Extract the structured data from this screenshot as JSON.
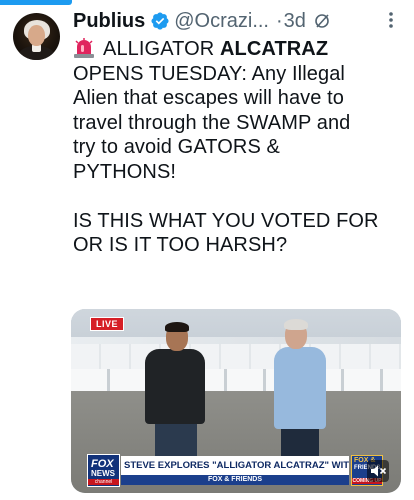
{
  "tweet": {
    "author_name": "Publius",
    "handle": "@Ocrazi...",
    "separator": "·",
    "time": "3d",
    "lines": [
      "ALLIGATOR ALCATRAZ",
      "OPENS TUESDAY: Any Illegal",
      "Alien that escapes will have to",
      "travel through the SWAMP and",
      "try to avoid GATORS &",
      "PYTHONS!",
      "IS THIS WHAT YOU VOTED FOR",
      "OR IS IT TOO HARSH?"
    ],
    "first_word": "ALLIGATOR",
    "first_bold": "ALCATRAZ"
  },
  "media": {
    "live_badge": "LIVE",
    "chyron_headline": "STEVE EXPLORES \"ALLIGATOR ALCATRAZ\" WITH DESANTIS",
    "show_name": "FOX & FRIENDS",
    "network_logo_line1": "FOX",
    "network_logo_line2": "NEWS",
    "network_logo_line3": "channel",
    "show_logo_line1": "FOX &",
    "show_logo_line2": "FRIENDS",
    "show_logo_line3": "COMING UP"
  },
  "colors": {
    "accent": "#1d9bf0",
    "verified": "#1d9bf0",
    "text": "#0f1419",
    "muted": "#536471",
    "siren": "#e0245e"
  },
  "icons": {
    "verified": "verified-badge-icon",
    "grok": "sparkle-icon",
    "more": "more-dots-icon",
    "siren": "siren-emoji-icon",
    "mute": "speaker-muted-icon"
  }
}
